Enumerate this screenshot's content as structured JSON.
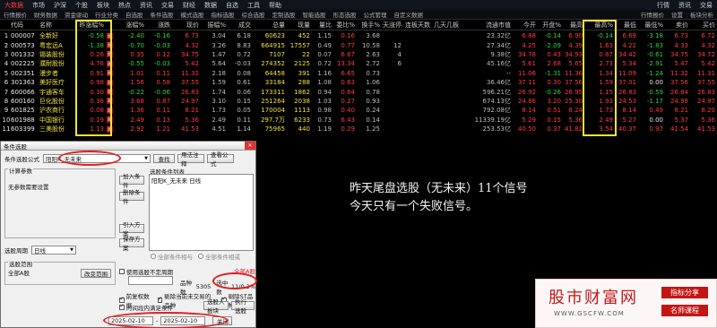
{
  "menubar": {
    "items": [
      "大数据",
      "市场",
      "沪深",
      "个股",
      "板块",
      "热点",
      "资讯",
      "交易",
      "财经",
      "数据",
      "自选",
      "工具",
      "帮助"
    ],
    "right_items": [
      "行情",
      "资讯",
      "交易"
    ]
  },
  "toolbar": {
    "items": [
      "行情报价",
      "财务数据",
      "资金驱动",
      "行业分类",
      "自选股",
      "条件选股",
      "模式选股",
      "指标选股",
      "综合选股",
      "定制选股",
      "智能选股",
      "形态选股",
      "公式管理",
      "自定义数据"
    ],
    "right_items": [
      "行情报价",
      "设置",
      "板块分析"
    ]
  },
  "table": {
    "columns": [
      "",
      "代码",
      "名称",
      "昨涨幅%",
      "",
      "涨幅%",
      "涨跌",
      "现价",
      "振幅%",
      "成交",
      "总量",
      "现量",
      "量比",
      "委比%",
      "换手%",
      "今天涨停",
      "连板天数",
      "几天几板",
      "流通市值",
      "今开",
      "开盘%",
      "最高",
      "最高%",
      "最低",
      "最低%",
      "卖价",
      "买价"
    ],
    "rows": [
      {
        "n": "1",
        "code": "000007",
        "name": "全新好",
        "prev": "-0.58",
        "chg": "-2.40",
        "diff": "-0.16",
        "price": "6.73",
        "amp": "3.04",
        "turn": "6.18",
        "vol": "60623",
        "cur": "452",
        "vr": "1.15",
        "wb": "0.16",
        "hs": "3.68",
        "zt": "",
        "lb": "",
        "open": "23.32亿",
        "op": "6.88",
        "opp": "-0.14",
        "hi": "6.90",
        "hip": "-0.14",
        "lo": "6.69",
        "lop": "-3.18",
        "sell": "6.73",
        "buy": "6.72"
      },
      {
        "n": "2",
        "code": "000573",
        "name": "粤宏远A",
        "prev": "-1.38",
        "chg": "-0.70",
        "diff": "-0.03",
        "price": "4.32",
        "amp": "3.26",
        "turn": "8.83",
        "vol": "664915",
        "cur": "17557",
        "vr": "0.49",
        "wb": "0.77",
        "hs": "10.58",
        "zt": "12",
        "lb": "",
        "open": "27.34亿",
        "op": "4.25",
        "opp": "-2.09",
        "hi": "4.39",
        "hip": "1.63",
        "lo": "4.22",
        "lop": "-1.83",
        "sell": "4.33",
        "buy": "4.32"
      },
      {
        "n": "3",
        "code": "001332",
        "name": "锡装股份",
        "prev": "0.26",
        "chg": "0.35",
        "diff": "0.12",
        "price": "34.75",
        "amp": "1.47",
        "turn": "0.72",
        "vol": "7107",
        "cur": "22",
        "vr": "0.07",
        "wb": "6.67",
        "hs": "2.63",
        "zt": "4",
        "lb": "",
        "open": "9.38亿",
        "op": "34.78",
        "opp": "0.43",
        "hi": "34.93",
        "hip": "0.87",
        "lo": "34.42",
        "lop": "-0.61",
        "sell": "34.75",
        "buy": "34.72"
      },
      {
        "n": "4",
        "code": "002225",
        "name": "濮耐股份",
        "prev": "4.76",
        "chg": "-0.55",
        "diff": "-0.03",
        "price": "5.42",
        "amp": "5.64",
        "turn": "-0.03",
        "vol": "274352",
        "cur": "2125",
        "vr": "0.72",
        "wb": "13.34",
        "hs": "2.72",
        "zt": "6",
        "lb": "",
        "open": "45.16亿",
        "op": "5.61",
        "opp": "2.68",
        "hi": "5.65",
        "hip": "2.73",
        "lo": "5.34",
        "lop": "-2.91",
        "sell": "5.47",
        "buy": "5.42"
      },
      {
        "n": "5",
        "code": "002351",
        "name": "漫步者",
        "prev": "0.91",
        "chg": "1.01",
        "diff": "0.11",
        "price": "11.32",
        "amp": "2.18",
        "turn": "0.08",
        "vol": "64458",
        "cur": "391",
        "vr": "1.16",
        "wb": "6.65",
        "hs": "0.73",
        "zt": "",
        "lb": "",
        "open": "-- ",
        "op": "11.06",
        "opp": "-1.31",
        "hi": "11.36",
        "hip": "1.34",
        "lo": "11.09",
        "lop": "-1.24",
        "sell": "11.32",
        "buy": "11.31"
      },
      {
        "n": "6",
        "code": "301363",
        "name": "美好医疗",
        "prev": "0.98",
        "chg": "1.56",
        "diff": "0.58",
        "price": "37.55",
        "amp": "1.59",
        "turn": "0.61",
        "vol": "33184",
        "cur": "288",
        "vr": "1.08",
        "wb": "0.63",
        "hs": "1.06",
        "zt": "",
        "lb": "",
        "open": "36.46亿",
        "op": "37.11",
        "opp": "0.30",
        "hi": "37.56",
        "hip": "1.59",
        "lo": "37.01",
        "lop": "0.00",
        "sell": "37.56",
        "buy": "37.55"
      },
      {
        "n": "7",
        "code": "600066",
        "name": "宇通客车",
        "prev": "0.30",
        "chg": "-0.22",
        "diff": "-0.06",
        "price": "26.83",
        "amp": "1.74",
        "turn": "0.06",
        "vol": "173311",
        "cur": "1862",
        "vr": "0.94",
        "wb": "0.64",
        "hs": "0.78",
        "zt": "",
        "lb": "",
        "open": "596.21亿",
        "op": "26.92",
        "opp": "-0.26",
        "hi": "26.95",
        "hip": "1.15",
        "lo": "26.83",
        "lop": "-0.59",
        "sell": "26.84",
        "buy": "26.83"
      },
      {
        "n": "8",
        "code": "600160",
        "name": "巨化股份",
        "prev": "0.36",
        "chg": "3.68",
        "diff": "0.87",
        "price": "24.97",
        "amp": "3.10",
        "turn": "0.15",
        "vol": "251264",
        "cur": "2038",
        "vr": "1.03",
        "wb": "0.27",
        "hs": "0.93",
        "zt": "",
        "lb": "",
        "open": "674.13亿",
        "op": "24.86",
        "opp": "3.20",
        "hi": "25.30",
        "hip": "1.93",
        "lo": "24.53",
        "lop": "-1.17",
        "sell": "24.98",
        "buy": "24.97"
      },
      {
        "n": "9",
        "code": "601825",
        "name": "沪农商行",
        "prev": "0.08",
        "chg": "1.36",
        "diff": "0.11",
        "price": "8.21",
        "amp": "1.73",
        "turn": "0.05",
        "vol": "170004",
        "cur": "1113",
        "vr": "0.98",
        "wb": "0.40",
        "hs": "0.24",
        "zt": "",
        "lb": "",
        "open": "792.08亿",
        "op": "8.14",
        "opp": "0.51",
        "hi": "8.24",
        "hip": "1.73",
        "lo": "8.14",
        "lop": "0.49",
        "sell": "8.21",
        "buy": "8.20"
      },
      {
        "n": "10",
        "code": "601988",
        "name": "中国银行",
        "prev": "0.19",
        "chg": "2.49",
        "diff": "0.13",
        "price": "5.36",
        "amp": "2.49",
        "turn": "0.11",
        "vol": "297.7万",
        "cur": "6233",
        "vr": "0.73",
        "wb": "6.43",
        "hs": "0.14",
        "zt": "",
        "lb": "",
        "open": "11339.19亿",
        "op": "5.29",
        "opp": "0.15",
        "hi": "5.36",
        "hip": "2.49",
        "lo": "5.27",
        "lop": "0.00",
        "sell": "5.37",
        "buy": "5.36"
      },
      {
        "n": "11",
        "code": "603399",
        "name": "三美股份",
        "prev": "1.13",
        "chg": "2.92",
        "diff": "1.21",
        "price": "41.53",
        "amp": "4.51",
        "turn": "1.14",
        "vol": "75965",
        "cur": "440",
        "vr": "1.19",
        "wb": "0.29",
        "hs": "1.25",
        "zt": "",
        "lb": "",
        "open": "253.53亿",
        "op": "40.50",
        "opp": "0.37",
        "hi": "41.82",
        "hip": "3.54",
        "lo": "40.37",
        "lop": "0.97",
        "sell": "41.54",
        "buy": "41.53"
      }
    ]
  },
  "dialog": {
    "title": "条件选股",
    "formula_label": "条件选股公式",
    "formula_value": "阳阳K_无未来",
    "btn_find": "查找",
    "btn_usage": "用法注释",
    "btn_view": "查看公式",
    "params_label": "计算参数",
    "params_text": "无参数需要设置",
    "btn_add": "加入条件",
    "btn_delete": "删除条件",
    "list_header": "选股条件列表",
    "list_item": "阳阳K_无未来 日线",
    "btn_import": "引入方案",
    "btn_save": "保存方案",
    "period_label": "选股周期",
    "period_value": "日线",
    "radio_and": "全部条件相与",
    "radio_or": "全部条件相或",
    "range_label": "选股范围",
    "range_value": "全部A股",
    "btn_change_range": "改变范围",
    "chk_nonstd": "使用选股不定周期",
    "nonstd_hint": "品种数",
    "count_label": "品种数",
    "count_value": "5305",
    "selected_label": "选中数",
    "selected_value": "11/0.2%",
    "chk_prev": "前复权数据",
    "chk_unlisted": "剔除当前未交易的品种",
    "chk_st": "剔除ST品种",
    "chk_interval": "时间段内满足条件",
    "btn_add_block": "选股入板块",
    "btn_exec": "执行选股",
    "date_from": "2025-02-10",
    "date_to": "2025-02-10",
    "btn_close": "关闭",
    "red_text": "全部A股"
  },
  "annotation": {
    "line1": "昨天尾盘选股（无未来）11个信号",
    "line2": "今天只有一个失败信号。"
  },
  "watermark": {
    "logo": "股市财富网",
    "url": "WWW.GSCFW.COM",
    "badge1": "指标分享",
    "badge2": "名师课程"
  },
  "colors": {
    "up": "#ff3c3c",
    "down": "#2fd63a",
    "highlight": "#f3e23a",
    "annotation_circle": "#e02020"
  }
}
